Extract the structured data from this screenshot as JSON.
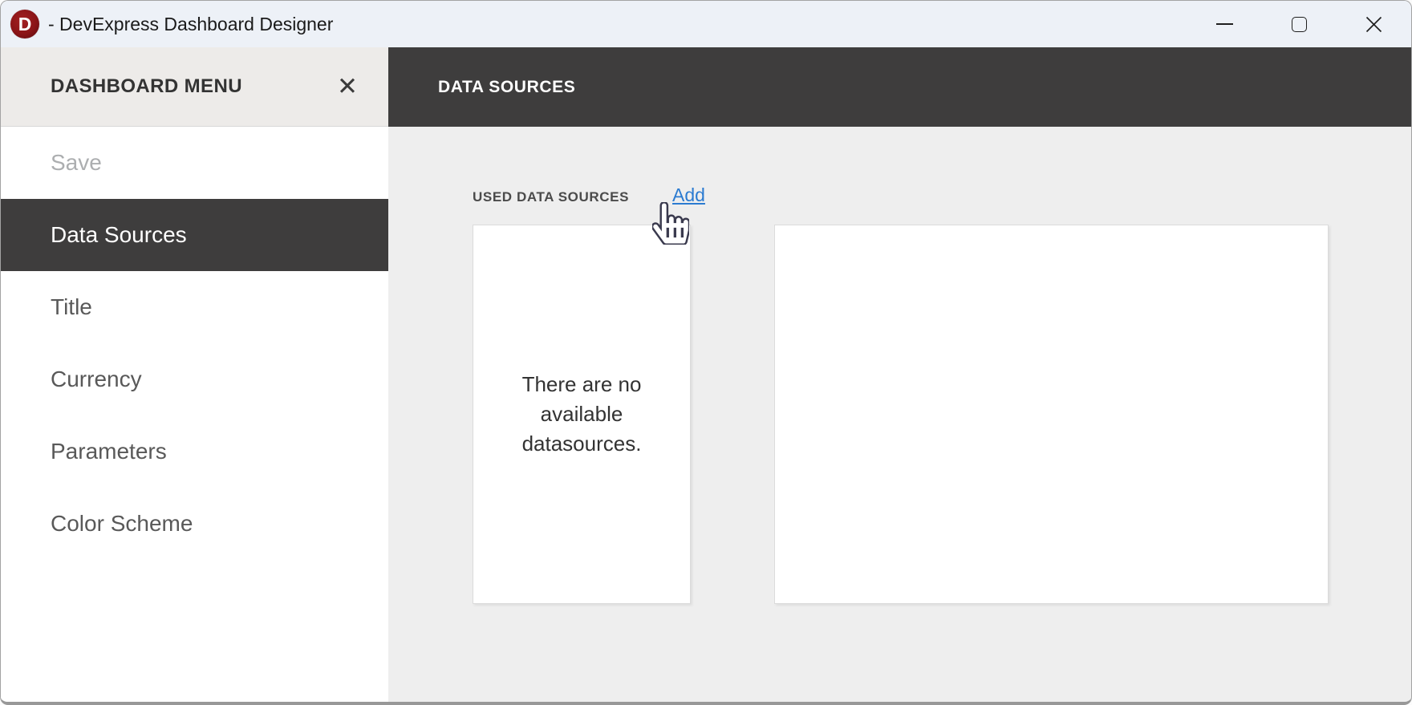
{
  "window": {
    "title": "- DevExpress Dashboard Designer",
    "logo_letter": "D"
  },
  "icons": {
    "menu_close": "✕",
    "window_minimize": "minimize-bar",
    "window_maximize": "square-outline",
    "window_close": "thin-x",
    "cursor": "hand-pointer"
  },
  "sidebar": {
    "header": "DASHBOARD MENU",
    "items": [
      {
        "label": "Save",
        "state": "disabled"
      },
      {
        "label": "Data Sources",
        "state": "selected"
      },
      {
        "label": "Title",
        "state": "normal"
      },
      {
        "label": "Currency",
        "state": "normal"
      },
      {
        "label": "Parameters",
        "state": "normal"
      },
      {
        "label": "Color Scheme",
        "state": "normal"
      }
    ]
  },
  "main": {
    "header": "DATA SOURCES",
    "used_sources_label": "USED DATA SOURCES",
    "add_link": "Add",
    "empty_message": "There are no available datasources."
  },
  "colors": {
    "brand_red": "#8a1417",
    "dark_header": "#3e3d3d",
    "accent_link": "#2b7bd1",
    "titlebar_bg": "#edf1f7",
    "sidebar_header_bg": "#edebe9",
    "content_bg": "#eeeeee"
  }
}
